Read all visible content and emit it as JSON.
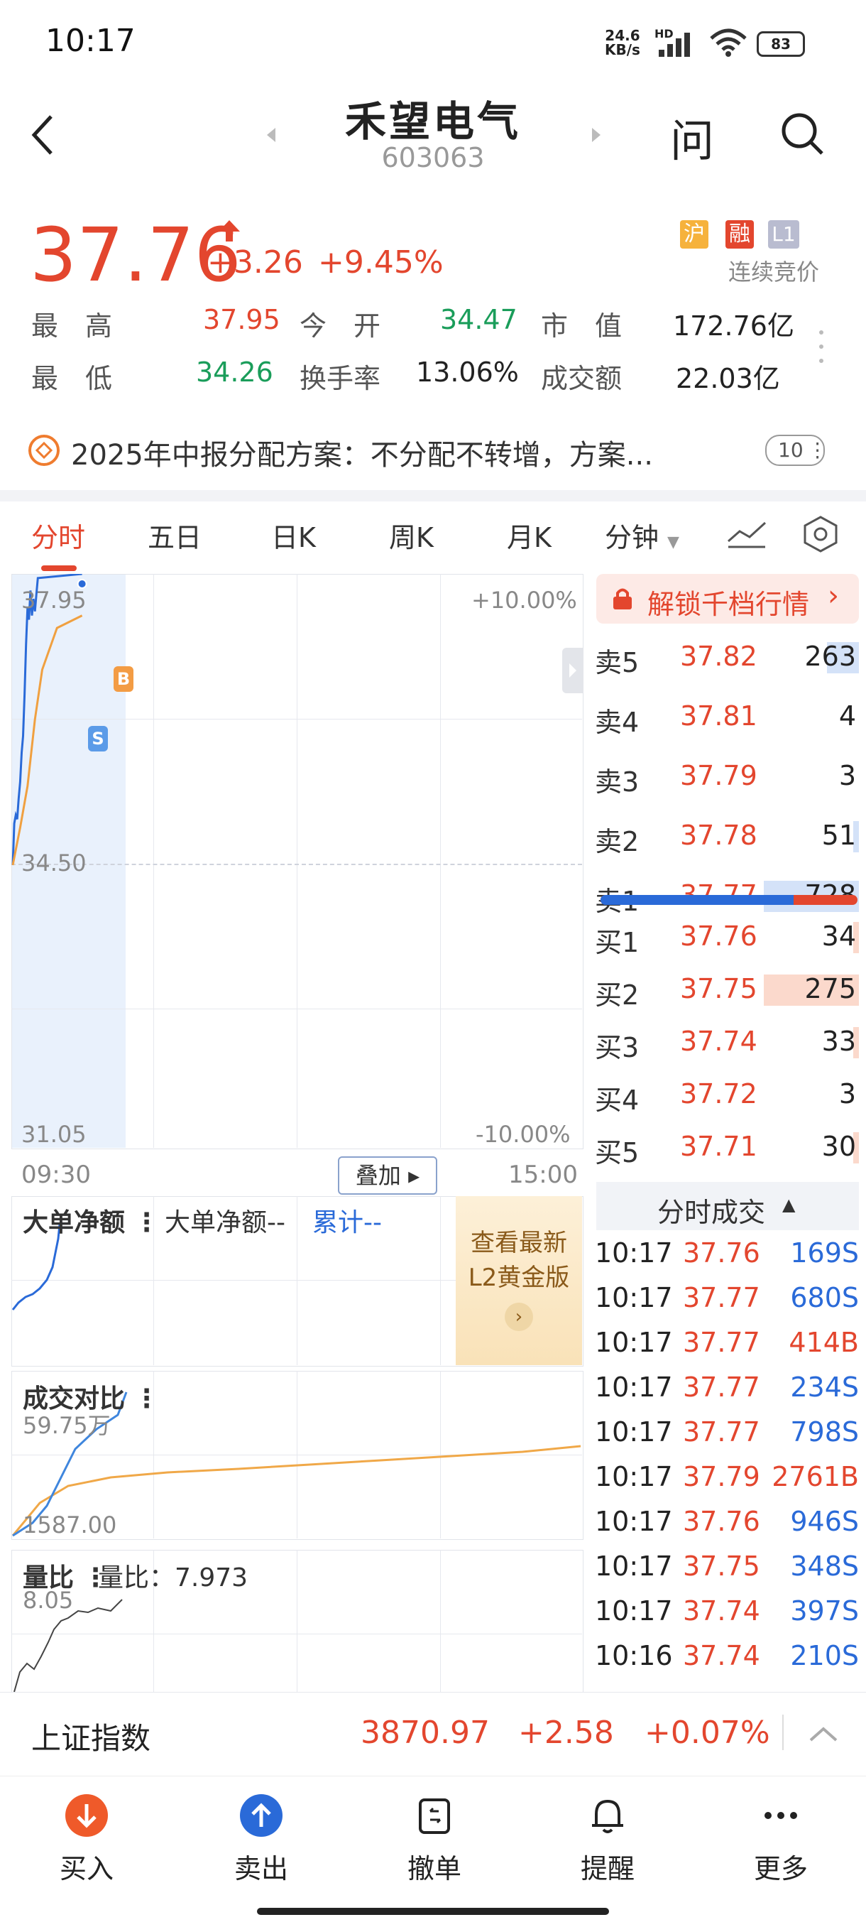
{
  "status_bar": {
    "time": "10:17",
    "net_speed": "24.6",
    "net_unit": "KB/s",
    "hd": "HD",
    "battery": "83"
  },
  "header": {
    "title": "禾望电气",
    "code": "603063",
    "ask_label": "问"
  },
  "quote": {
    "price": "37.76",
    "change": "+3.26",
    "change_pct": "+9.45%",
    "badges": [
      "沪",
      "融",
      "L1"
    ],
    "auction_status": "连续竞价",
    "stats": [
      {
        "label": "最　高",
        "value": "37.95",
        "color": "red"
      },
      {
        "label": "今　开",
        "value": "34.47",
        "color": "green"
      },
      {
        "label": "市　值",
        "value": "172.76亿",
        "color": "black"
      },
      {
        "label": "最　低",
        "value": "34.26",
        "color": "green"
      },
      {
        "label": "换手率",
        "value": "13.06%",
        "color": "black"
      },
      {
        "label": "成交额",
        "value": "22.03亿",
        "color": "black"
      }
    ]
  },
  "notice": {
    "text": "2025年中报分配方案：不分配不转增，方案...",
    "count": "10"
  },
  "tabs": [
    "分时",
    "五日",
    "日K",
    "周K",
    "月K",
    "分钟"
  ],
  "chart": {
    "y_top": "37.95",
    "y_mid": "34.50",
    "y_bottom": "31.05",
    "pct_top": "+10.00%",
    "pct_bottom": "-10.00%",
    "x_start": "09:30",
    "x_end": "15:00",
    "overlay_btn": "叠加",
    "marker_b": "B",
    "marker_s": "S"
  },
  "chart_data": {
    "type": "line",
    "title": "",
    "ylim": [
      31.05,
      37.95
    ],
    "series": [
      {
        "name": "",
        "x": [
          "09:30",
          "09:31",
          "09:32",
          "09:33",
          "09:34",
          "09:35",
          "09:36",
          "09:37",
          "09:38",
          "09:39",
          "09:40",
          "09:41",
          "09:42",
          "09:43",
          "09:44",
          "09:45",
          "09:46",
          "09:47",
          "10:17"
        ],
        "values": [
          34.45,
          34.95,
          35.05,
          35.0,
          35.25,
          35.45,
          35.8,
          36.0,
          36.5,
          37.1,
          37.55,
          37.4,
          37.75,
          37.45,
          37.65,
          37.5,
          37.7,
          37.9,
          37.95
        ]
      },
      {
        "name": "",
        "x": [
          "09:30",
          "09:35",
          "09:40",
          "09:45",
          "09:50",
          "10:00",
          "10:17"
        ],
        "values": [
          34.45,
          34.9,
          35.4,
          36.2,
          36.8,
          37.3,
          37.45
        ]
      }
    ]
  },
  "big_order": {
    "title": "大单净额",
    "label": "大单净额--",
    "cumulative": "累计--",
    "promo_line1": "查看最新",
    "promo_line2": "L2黄金版"
  },
  "volume_compare": {
    "title": "成交对比",
    "top": "59.75万",
    "bottom": "1587.00"
  },
  "volume_ratio": {
    "title": "量比",
    "label": "量比：7.973",
    "top": "8.05"
  },
  "orderbook": {
    "unlock": "解锁千档行情",
    "asks": [
      {
        "label": "卖5",
        "price": "37.82",
        "vol": "263",
        "bar": 0.12
      },
      {
        "label": "卖4",
        "price": "37.81",
        "vol": "4",
        "bar": 0.0
      },
      {
        "label": "卖3",
        "price": "37.79",
        "vol": "3",
        "bar": 0.0
      },
      {
        "label": "卖2",
        "price": "37.78",
        "vol": "51",
        "bar": 0.02
      },
      {
        "label": "卖1",
        "price": "37.77",
        "vol": "728",
        "bar": 0.36
      }
    ],
    "bids": [
      {
        "label": "买1",
        "price": "37.76",
        "vol": "34",
        "bar": 0.02
      },
      {
        "label": "买2",
        "price": "37.75",
        "vol": "275",
        "bar": 0.36
      },
      {
        "label": "买3",
        "price": "37.74",
        "vol": "33",
        "bar": 0.02
      },
      {
        "label": "买4",
        "price": "37.72",
        "vol": "3",
        "bar": 0.0
      },
      {
        "label": "买5",
        "price": "37.71",
        "vol": "30",
        "bar": 0.02
      }
    ],
    "ratio_buy": 0.75
  },
  "trades": {
    "title": "分时成交",
    "rows": [
      {
        "time": "10:17",
        "price": "37.76",
        "vol": "169S",
        "side": "S"
      },
      {
        "time": "10:17",
        "price": "37.77",
        "vol": "680S",
        "side": "S"
      },
      {
        "time": "10:17",
        "price": "37.77",
        "vol": "414B",
        "side": "B"
      },
      {
        "time": "10:17",
        "price": "37.77",
        "vol": "234S",
        "side": "S"
      },
      {
        "time": "10:17",
        "price": "37.77",
        "vol": "798S",
        "side": "S"
      },
      {
        "time": "10:17",
        "price": "37.79",
        "vol": "2761B",
        "side": "B"
      },
      {
        "time": "10:17",
        "price": "37.76",
        "vol": "946S",
        "side": "S"
      },
      {
        "time": "10:17",
        "price": "37.75",
        "vol": "348S",
        "side": "S"
      },
      {
        "time": "10:17",
        "price": "37.74",
        "vol": "397S",
        "side": "S"
      },
      {
        "time": "10:16",
        "price": "37.74",
        "vol": "210S",
        "side": "S"
      }
    ]
  },
  "index_bar": {
    "name": "上证指数",
    "value": "3870.97",
    "change": "+2.58",
    "pct": "+0.07%"
  },
  "bottom_nav": [
    "买入",
    "卖出",
    "撤单",
    "提醒",
    "更多"
  ]
}
